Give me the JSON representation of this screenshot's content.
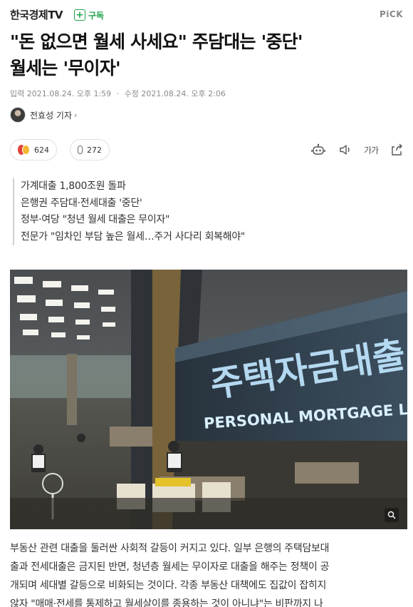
{
  "header": {
    "brand": "한국경제TV",
    "subscribe_icon": "plus-icon",
    "subscribe_label": "구독",
    "pick_label": "PiCK",
    "accent_color": "#1fa34a"
  },
  "article": {
    "title_line1": "\"돈 없으면 월세 사세요\" 주담대는 '중단'",
    "title_line2": "월세는 '무이자'",
    "published_label": "입력",
    "published_date": "2021.08.24. 오후 1:59",
    "modified_label": "수정",
    "modified_date": "2021.08.24. 오후 2:06",
    "author": "전효성 기자",
    "reactions_count": "624",
    "comments_count": "272",
    "font_size_label": "가가",
    "summary": [
      "가계대출 1,800조원 돌파",
      "은행권 주담대·전세대출 '중단'",
      "정부·여당 \"청년 월세 대출은 무이자\"",
      "전문가 \"임차인 부담 높은 월세…주거 사다리 회복해야\""
    ],
    "photo": {
      "sign_korean": "주택자금대출",
      "sign_english": "PERSONAL MORTGAGE LOAN"
    },
    "body_lines": [
      "부동산 관련 대출을 둘러싼 사회적 갈등이 커지고 있다. 일부 은행의 주택담보대",
      "출과 전세대출은 금지된 반면, 청년층 월세는 무이자로 대출을 해주는 정책이 공",
      "개되며 세대별 갈등으로 비화되는 것이다. 각종 부동산 대책에도 집값이 잡히지",
      "않자 \"매매·전세를 통제하고 월세살이를 종용하는 것이 아니냐\"는 비판까지 나"
    ]
  }
}
